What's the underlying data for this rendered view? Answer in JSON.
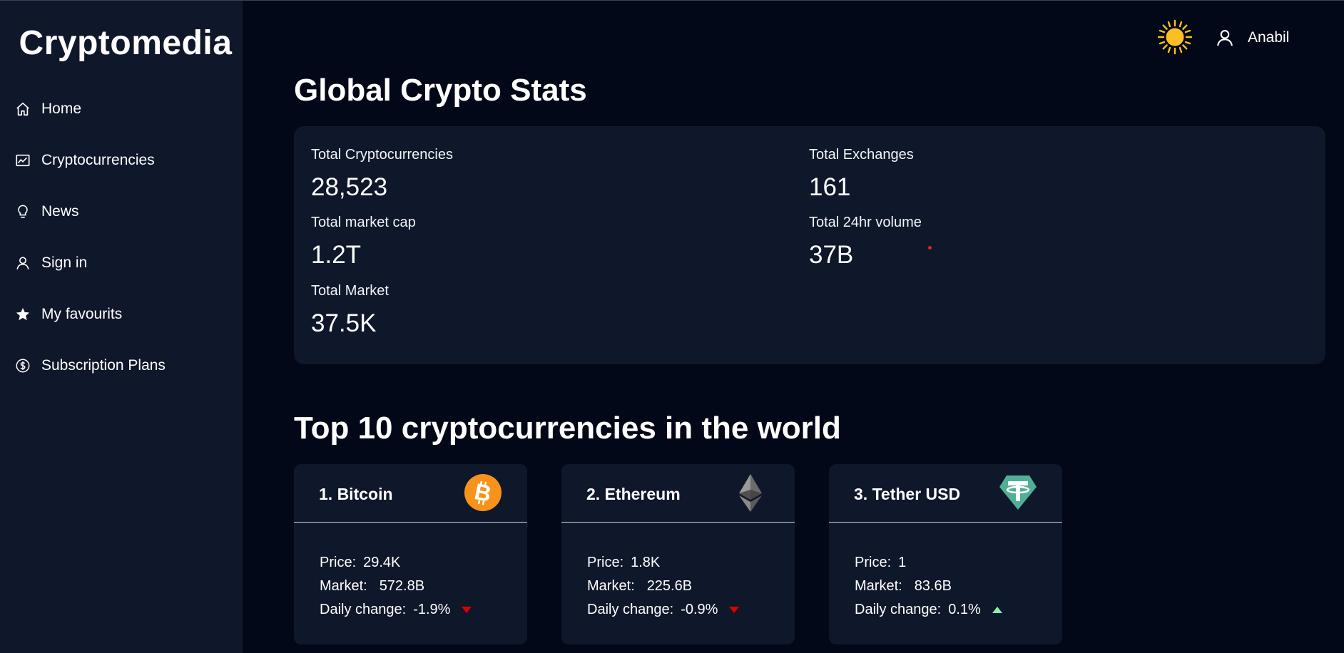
{
  "app": {
    "brand": "Cryptomedia"
  },
  "sidebar": {
    "items": [
      {
        "label": "Home",
        "icon": "home-icon"
      },
      {
        "label": "Cryptocurrencies",
        "icon": "chart-icon"
      },
      {
        "label": "News",
        "icon": "lightbulb-icon"
      },
      {
        "label": "Sign in",
        "icon": "user-icon"
      },
      {
        "label": "My favourits",
        "icon": "star-icon"
      },
      {
        "label": "Subscription Plans",
        "icon": "dollar-circle-icon"
      }
    ]
  },
  "header": {
    "theme_icon": "sun-icon",
    "user_name": "Anabil"
  },
  "stats": {
    "title": "Global Crypto Stats",
    "items": [
      {
        "label": "Total Cryptocurrencies",
        "value": "28,523"
      },
      {
        "label": "Total Exchanges",
        "value": "161"
      },
      {
        "label": "Total market cap",
        "value": "1.2T"
      },
      {
        "label": "Total 24hr volume",
        "value": "37B"
      },
      {
        "label": "Total Market",
        "value": "37.5K"
      }
    ]
  },
  "top10": {
    "title": "Top 10 cryptocurrencies in the world",
    "price_label": "Price:",
    "market_label": "Market:",
    "change_label": "Daily change:",
    "coins": [
      {
        "name": "1. Bitcoin",
        "price": "29.4K",
        "market": "572.8B",
        "change": "-1.9%",
        "direction": "down",
        "icon": "bitcoin-logo-icon"
      },
      {
        "name": "2. Ethereum",
        "price": "1.8K",
        "market": "225.6B",
        "change": "-0.9%",
        "direction": "down",
        "icon": "ethereum-logo-icon"
      },
      {
        "name": "3. Tether USD",
        "price": "1",
        "market": "83.6B",
        "change": "0.1%",
        "direction": "up",
        "icon": "tether-logo-icon"
      }
    ]
  },
  "colors": {
    "background": "#020817",
    "panel": "#0f172a",
    "down": "#dc0000",
    "up": "#86efac",
    "sun": "#fbbf24"
  }
}
